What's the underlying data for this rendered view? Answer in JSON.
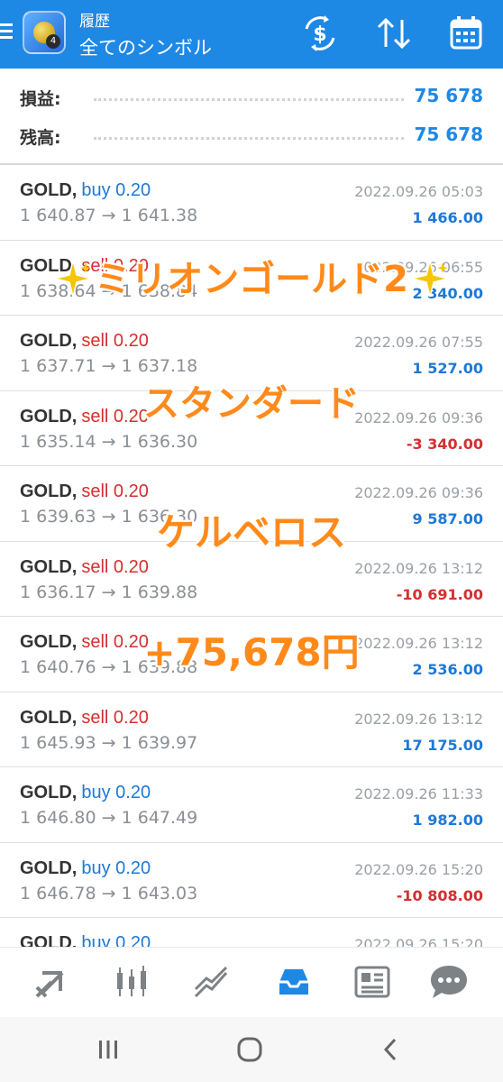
{
  "header": {
    "title": "履歴",
    "subtitle": "全てのシンボル",
    "icons": [
      "menu-icon",
      "app-icon",
      "currency-icon",
      "sort-icon",
      "calendar-icon"
    ]
  },
  "summary": {
    "profit_label": "損益:",
    "profit_value": "75 678",
    "balance_label": "残高:",
    "balance_value": "75 678"
  },
  "deals": [
    {
      "symbol": "GOLD,",
      "type": "buy 0.20",
      "side": "buy",
      "prices": "1 640.87 → 1 641.38",
      "time": "2022.09.26 05:03",
      "profit": "1 466.00",
      "sign": "pos"
    },
    {
      "symbol": "GOLD,",
      "type": "sell 0.20",
      "side": "sell",
      "prices": "1 638.64 → 1 638.84",
      "time": "2022.09.26 06:55",
      "profit": "2 340.00",
      "sign": "pos"
    },
    {
      "symbol": "GOLD,",
      "type": "sell 0.20",
      "side": "sell",
      "prices": "1 637.71 → 1 637.18",
      "time": "2022.09.26 07:55",
      "profit": "1 527.00",
      "sign": "pos"
    },
    {
      "symbol": "GOLD,",
      "type": "sell 0.20",
      "side": "sell",
      "prices": "1 635.14 → 1 636.30",
      "time": "2022.09.26 09:36",
      "profit": "-3 340.00",
      "sign": "neg"
    },
    {
      "symbol": "GOLD,",
      "type": "sell 0.20",
      "side": "sell",
      "prices": "1 639.63 → 1 636.30",
      "time": "2022.09.26 09:36",
      "profit": "9 587.00",
      "sign": "pos"
    },
    {
      "symbol": "GOLD,",
      "type": "sell 0.20",
      "side": "sell",
      "prices": "1 636.17 → 1 639.88",
      "time": "2022.09.26 13:12",
      "profit": "-10 691.00",
      "sign": "neg"
    },
    {
      "symbol": "GOLD,",
      "type": "sell 0.20",
      "side": "sell",
      "prices": "1 640.76 → 1 639.88",
      "time": "2022.09.26 13:12",
      "profit": "2 536.00",
      "sign": "pos"
    },
    {
      "symbol": "GOLD,",
      "type": "sell 0.20",
      "side": "sell",
      "prices": "1 645.93 → 1 639.97",
      "time": "2022.09.26 13:12",
      "profit": "17 175.00",
      "sign": "pos"
    },
    {
      "symbol": "GOLD,",
      "type": "buy 0.20",
      "side": "buy",
      "prices": "1 646.80 → 1 647.49",
      "time": "2022.09.26 11:33",
      "profit": "1 982.00",
      "sign": "pos"
    },
    {
      "symbol": "GOLD,",
      "type": "buy 0.20",
      "side": "buy",
      "prices": "1 646.78 → 1 643.03",
      "time": "2022.09.26 15:20",
      "profit": "-10 808.00",
      "sign": "neg"
    },
    {
      "symbol": "GOLD,",
      "type": "buy 0.20",
      "side": "buy",
      "prices": "",
      "time": "2022.09.26 15:20",
      "profit": "",
      "sign": "pos"
    }
  ],
  "overlay": {
    "line1": "ミリオンゴールド2",
    "line2": "スタンダード",
    "line3": "ケルベロス",
    "line4": "+75,678円"
  },
  "colors": {
    "header_bg": "#1e88e5",
    "positive": "#1e78d8",
    "negative": "#d32f2f",
    "overlay_text": "#ff8a1a",
    "sparkle": "#f7c600"
  },
  "bottom_nav": {
    "items": [
      "trade-icon",
      "chart-candles-icon",
      "chart-line-icon",
      "history-inbox-icon",
      "news-icon",
      "chat-icon"
    ],
    "active": "history-inbox-icon"
  },
  "system_nav": [
    "recent-apps-icon",
    "home-icon",
    "back-icon"
  ]
}
